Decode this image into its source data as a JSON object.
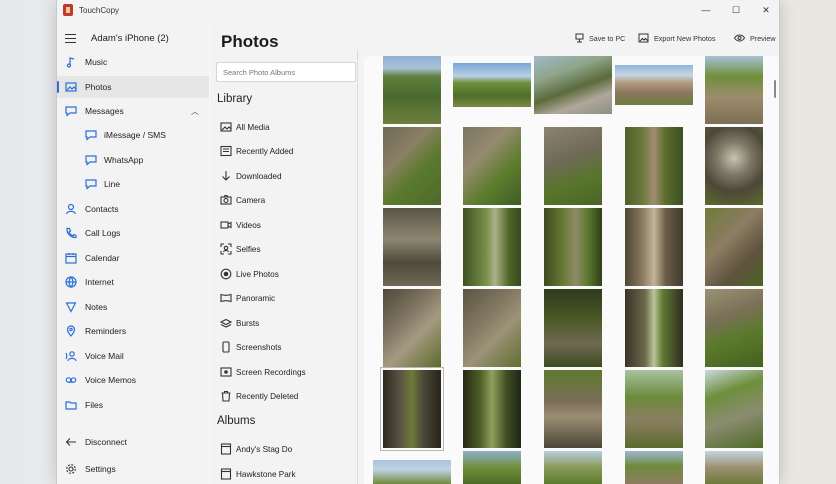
{
  "app": {
    "title": "TouchCopy"
  },
  "window_controls": {
    "minimize": "—",
    "maximize": "☐",
    "close": "✕"
  },
  "device": {
    "name": "Adam's iPhone (2)"
  },
  "nav": {
    "music": "Music",
    "photos": "Photos",
    "messages": "Messages",
    "imessage": "iMessage / SMS",
    "whatsapp": "WhatsApp",
    "line": "Line",
    "contacts": "Contacts",
    "call_logs": "Call Logs",
    "calendar": "Calendar",
    "internet": "Internet",
    "notes": "Notes",
    "reminders": "Reminders",
    "voice_mail": "Voice Mail",
    "voice_memos": "Voice Memos",
    "files": "Files",
    "disconnect": "Disconnect",
    "settings": "Settings"
  },
  "photos": {
    "title": "Photos",
    "search_placeholder": "Search Photo Albums",
    "library_heading": "Library",
    "library": {
      "all_media": "All Media",
      "recently_added": "Recently Added",
      "downloaded": "Downloaded",
      "camera": "Camera",
      "videos": "Videos",
      "selfies": "Selfies",
      "live_photos": "Live Photos",
      "panoramic": "Panoramic",
      "bursts": "Bursts",
      "screenshots": "Screenshots",
      "screen_recordings": "Screen Recordings",
      "recently_deleted": "Recently Deleted"
    },
    "albums_heading": "Albums",
    "albums": {
      "andys_stag_do": "Andy's Stag Do",
      "hawkstone_park": "Hawkstone Park"
    }
  },
  "toolbar": {
    "save_to_pc": "Save to PC",
    "export_new_photos": "Export New Photos",
    "preview": "Preview"
  },
  "colors": {
    "accent": "#2a6fd6",
    "sidebar_bg": "#f3f3f3",
    "content_bg": "#fafafa"
  }
}
